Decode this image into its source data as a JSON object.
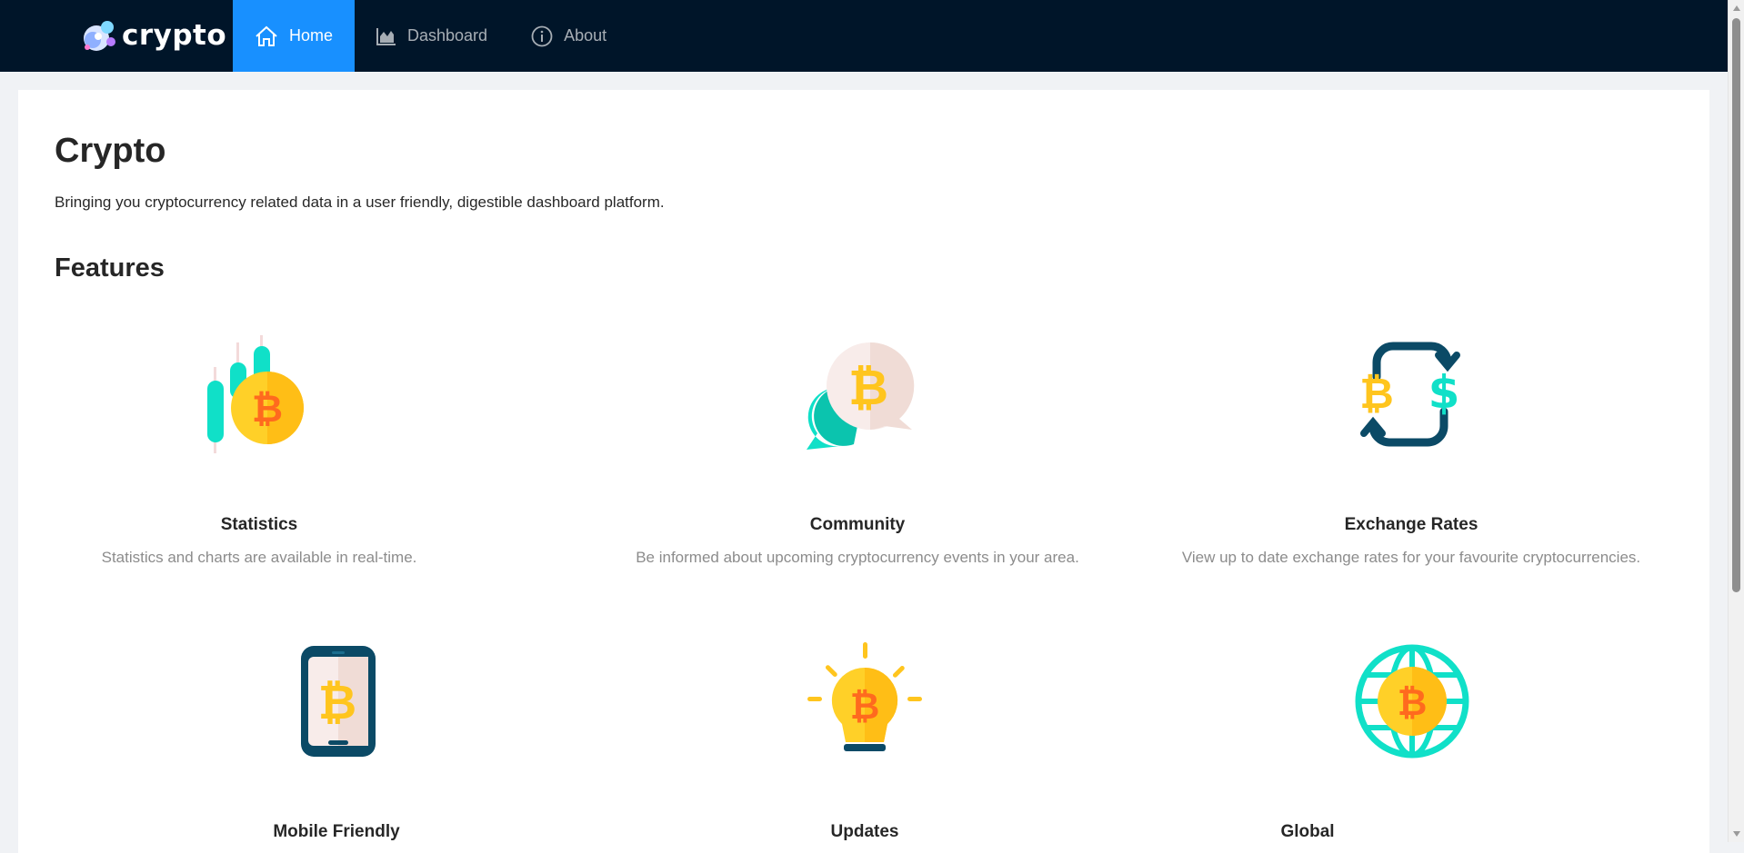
{
  "brand": {
    "name": "crypto"
  },
  "nav": [
    {
      "label": "Home",
      "icon": "home-icon",
      "active": true
    },
    {
      "label": "Dashboard",
      "icon": "area-chart-icon",
      "active": false
    },
    {
      "label": "About",
      "icon": "info-icon",
      "active": false
    }
  ],
  "main": {
    "title": "Crypto",
    "subtitle": "Bringing you cryptocurrency related data in a user friendly, digestible dashboard platform.",
    "features_heading": "Features",
    "features": [
      {
        "title": "Statistics",
        "description": "Statistics and charts are available in real-time.",
        "icon": "candlestick-bitcoin-icon"
      },
      {
        "title": "Community",
        "description": "Be informed about upcoming cryptocurrency events in your area.",
        "icon": "chat-bitcoin-icon"
      },
      {
        "title": "Exchange Rates",
        "description": "View up to date exchange rates for your favourite cryptocurrencies.",
        "icon": "exchange-bitcoin-dollar-icon"
      },
      {
        "title": "Mobile Friendly",
        "description": "",
        "icon": "phone-bitcoin-icon"
      },
      {
        "title": "Updates",
        "description": "",
        "icon": "lightbulb-bitcoin-icon"
      },
      {
        "title": "Global",
        "description": "",
        "icon": "globe-bitcoin-icon"
      }
    ]
  },
  "colors": {
    "header_bg": "#001529",
    "active_nav": "#1890ff",
    "page_bg": "#f0f2f5",
    "teal": "#10e0c8",
    "yellow": "#ffd028",
    "orange": "#ff8a1e",
    "navy": "#0b4a66"
  }
}
